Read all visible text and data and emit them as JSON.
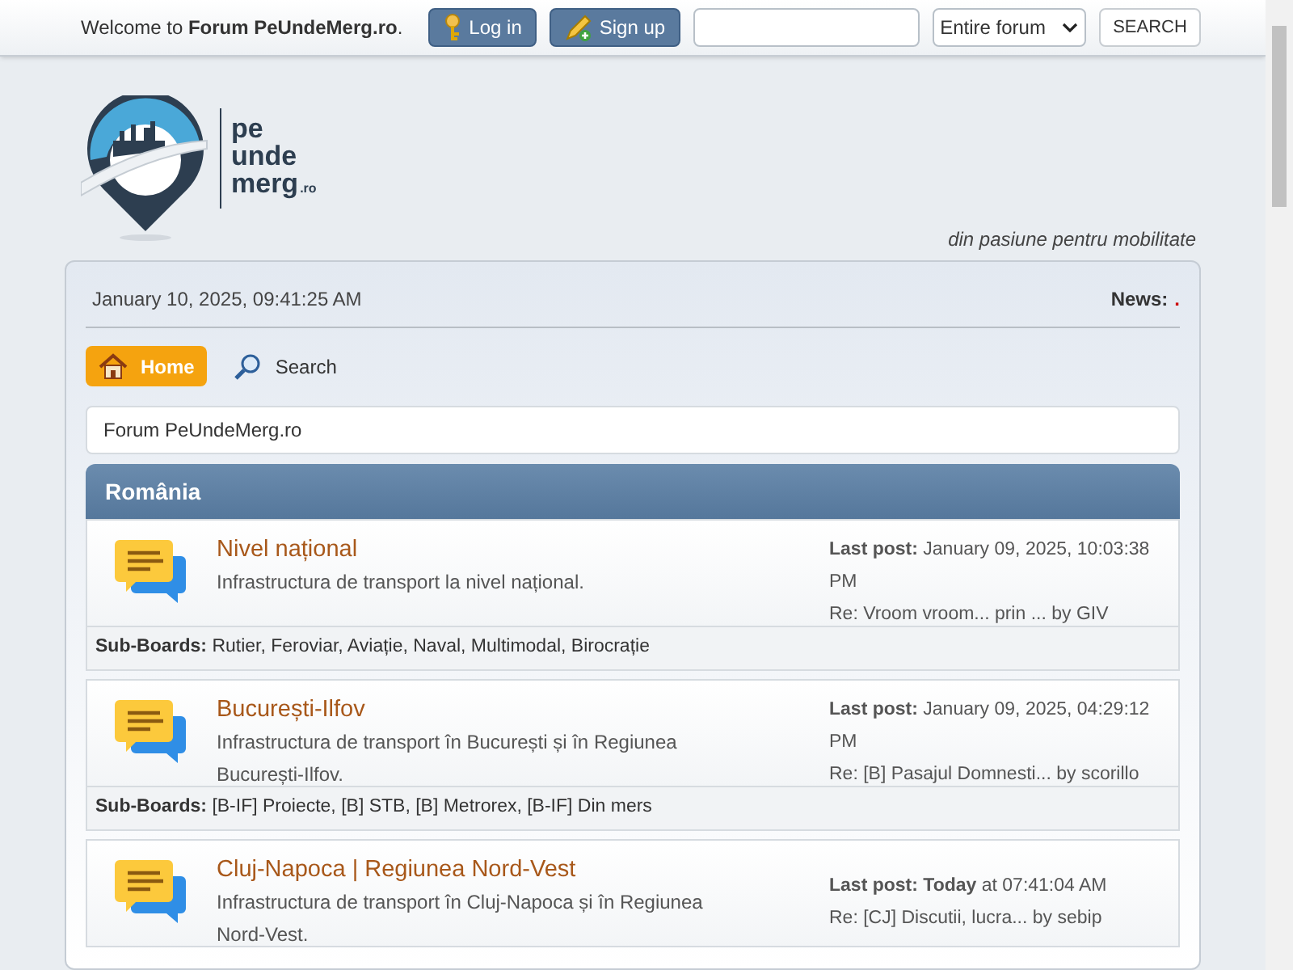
{
  "top_bar": {
    "welcome": "Welcome to **Forum PeUndeMerg.ro**.",
    "buttons": [
      {
        "kind": "login",
        "label": "Log in"
      },
      {
        "kind": "signup",
        "label": "Sign up"
      }
    ],
    "scope_select": {
      "value": "Entire forum"
    },
    "search_button": "SEARCH"
  },
  "logo": {
    "lines": [
      "pe",
      "unde",
      "merg"
    ],
    "suffix": ".ro"
  },
  "tagline": "din pasiune pentru mobilitate",
  "header": {
    "datetime": "January 10, 2025, 09:41:25 AM",
    "news_label": "News:",
    "news_value": "."
  },
  "nav": [
    {
      "kind": "home",
      "label": "Home",
      "selected": true
    },
    {
      "kind": "search",
      "label": "Search",
      "selected": false
    }
  ],
  "breadcrumb": "Forum PeUndeMerg.ro",
  "category": {
    "title": "România",
    "boards": [
      {
        "name": "Nivel național",
        "description": "Infrastructura de transport la nivel național.",
        "last_post": "**Last post:** January 09, 2025, 10:03:38 PM",
        "last_topic": "Re: Vroom vroom... prin ... by GIV",
        "sub_boards": "**Sub-Boards:** Rutier, Feroviar, Aviație, Naval, Multimodal, Birocrație"
      },
      {
        "name": "București-Ilfov",
        "description": "Infrastructura de transport în București și în Regiunea București-Ilfov.",
        "last_post": "**Last post:** January 09, 2025, 04:29:12 PM",
        "last_topic": "Re: [B] Pasajul Domnesti... by scorillo",
        "sub_boards": "**Sub-Boards:** [B-IF] Proiecte, [B] STB, [B] Metrorex, [B-IF] Din mers"
      },
      {
        "name": "Cluj-Napoca | Regiunea Nord-Vest",
        "description": "Infrastructura de transport în Cluj-Napoca și în Regiunea Nord-Vest.",
        "last_post": "**Last post:** **Today** at 07:41:04 AM",
        "last_topic": "Re: [CJ] Discutii, lucra... by sebip"
      }
    ]
  }
}
